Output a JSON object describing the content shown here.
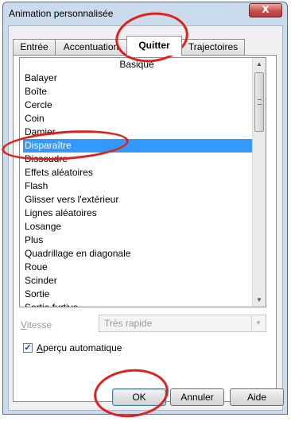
{
  "window": {
    "title": "Animation personnalisée",
    "close_glyph": "X"
  },
  "tabs": [
    {
      "label": "Entrée"
    },
    {
      "label": "Accentuation"
    },
    {
      "label": "Quitter",
      "active": true
    },
    {
      "label": "Trajectoires"
    }
  ],
  "list": {
    "header": "Basique",
    "selected_index": 5,
    "items": [
      "Balayer",
      "Boîte",
      "Cercle",
      "Coin",
      "Damier",
      "Disparaître",
      "Dissoudre",
      "Effets aléatoires",
      "Flash",
      "Glisser vers l'extérieur",
      "Lignes aléatoires",
      "Losange",
      "Plus",
      "Quadrillage en diagonale",
      "Roue",
      "Scinder",
      "Sortie",
      "Sortie furtive"
    ]
  },
  "speed": {
    "label": "Vitesse",
    "value": "Très rapide",
    "enabled": false
  },
  "preview": {
    "label": "Aperçu automatique",
    "checked": true
  },
  "buttons": {
    "ok": "OK",
    "cancel": "Annuler",
    "help": "Aide"
  },
  "colors": {
    "annotation": "#e0201c",
    "selection": "#3399ff"
  }
}
